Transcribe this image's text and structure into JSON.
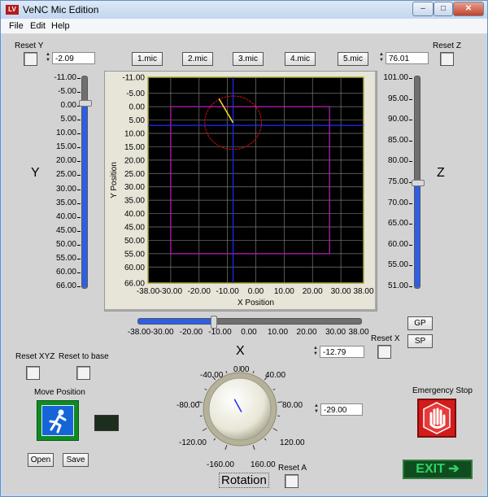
{
  "window": {
    "title": "VeNC Mic Edition",
    "app_icon": "LV",
    "minimize_glyph": "–",
    "maximize_glyph": "□",
    "close_glyph": "✕"
  },
  "menu": [
    "File",
    "Edit",
    "Help"
  ],
  "mic_buttons": [
    "1.mic",
    "2.mic",
    "3.mic",
    "4.mic",
    "5.mic"
  ],
  "y_axis": {
    "reset_label": "Reset Y",
    "value": "-2.09",
    "label": "Y",
    "ticks": [
      "-11.00",
      "-5.00",
      "0.00",
      "5.00",
      "10.00",
      "15.00",
      "20.00",
      "25.00",
      "30.00",
      "35.00",
      "40.00",
      "45.00",
      "50.00",
      "55.00",
      "60.00",
      "66.00"
    ],
    "slider_value": -2.09
  },
  "z_axis": {
    "reset_label": "Reset Z",
    "value": "76.01",
    "label": "Z",
    "ticks": [
      "101.00",
      "95.00",
      "90.00",
      "85.00",
      "80.00",
      "75.00",
      "70.00",
      "65.00",
      "60.00",
      "55.00",
      "51.00"
    ],
    "slider_value": 76.01
  },
  "x_axis": {
    "reset_label": "Reset X",
    "value": "-12.79",
    "label": "X",
    "ticks": [
      "-38.00",
      "-30.00",
      "-20.00",
      "-10.00",
      "0.00",
      "10.00",
      "20.00",
      "30.00",
      "38.00"
    ],
    "slider_value": -12.79
  },
  "graph": {
    "xlabel": "X Position",
    "ylabel": "Y Position",
    "x_ticks": [
      "-38.00",
      "-30.00",
      "-20.00",
      "-10.00",
      "0.00",
      "10.00",
      "20.00",
      "30.00",
      "38.00"
    ],
    "y_ticks": [
      "-11.00",
      "-5.00",
      "0.00",
      "5.00",
      "10.00",
      "15.00",
      "20.00",
      "25.00",
      "30.00",
      "35.00",
      "40.00",
      "45.00",
      "50.00",
      "55.00",
      "60.00",
      "66.00"
    ],
    "xlim": [
      -38,
      38
    ],
    "ylim": [
      -11,
      66
    ],
    "boundary_rect": {
      "x": [
        -30,
        26
      ],
      "y": [
        0,
        55
      ]
    },
    "cursor": {
      "x": -8,
      "y": 7
    },
    "circle": {
      "cx": -8,
      "cy": 6,
      "r": 10
    },
    "pointer_end": {
      "x": -13,
      "y": -3
    },
    "colors": {
      "bg": "#000000",
      "grid": "#7a7a7a",
      "rect": "#b020b0",
      "cursor": "#1a2cff",
      "circle": "#d01010",
      "pointer": "#ffe020",
      "border": "#d6d600"
    }
  },
  "gp_button": "GP",
  "sp_button": "SP",
  "reset_xyz": "Reset XYZ",
  "reset_base": "Reset to base",
  "move_position": "Move Position",
  "open_button": "Open",
  "save_button": "Save",
  "rotation": {
    "label": "Rotation",
    "value": "-29.00",
    "angle": -29,
    "ticks": [
      "-40.00",
      "0.00",
      "40.00",
      "-80.00",
      "80.00",
      "-120.00",
      "120.00",
      "-160.00",
      "160.00"
    ],
    "reset_label": "Reset A"
  },
  "emergency_stop": "Emergency Stop",
  "exit_label": "EXIT ➔"
}
